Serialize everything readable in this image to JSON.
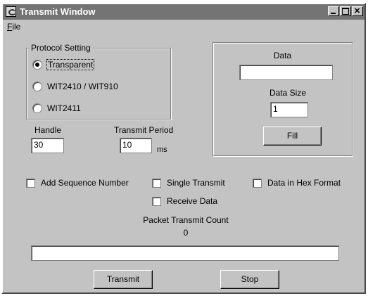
{
  "window": {
    "title": "Transmit Window"
  },
  "menu": {
    "file_underlined": "F",
    "file_rest": "ile"
  },
  "protocol": {
    "group_title": "Protocol Setting",
    "options": [
      {
        "label": "Transparent",
        "selected": true
      },
      {
        "label": "WIT2410 / WIT910",
        "selected": false
      },
      {
        "label": "WIT2411",
        "selected": false
      }
    ]
  },
  "data_panel": {
    "data_label": "Data",
    "data_value": "",
    "size_label": "Data Size",
    "size_value": "1",
    "fill_label": "Fill"
  },
  "handle": {
    "label": "Handle",
    "value": "30"
  },
  "period": {
    "label": "Transmit Period",
    "value": "10",
    "unit": "ms"
  },
  "options": {
    "add_sequence": {
      "label": "Add Sequence Number",
      "checked": false
    },
    "single_transmit": {
      "label": "Single Transmit",
      "checked": false
    },
    "hex_format": {
      "label": "Data in Hex Format",
      "checked": false
    },
    "receive_data": {
      "label": "Receive Data",
      "checked": false
    }
  },
  "counter": {
    "label": "Packet Transmit Count",
    "value": "0"
  },
  "progress": {
    "value": 0
  },
  "buttons": {
    "transmit": "Transmit",
    "stop": "Stop"
  }
}
